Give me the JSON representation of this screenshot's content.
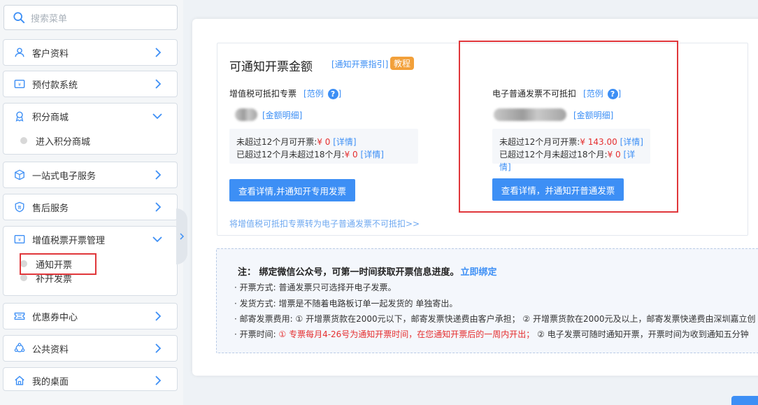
{
  "sidebar": {
    "search_placeholder": "搜索菜单",
    "items": [
      {
        "label": "客户资料"
      },
      {
        "label": "预付款系统"
      },
      {
        "label": "积分商城",
        "sub": [
          "进入积分商城"
        ]
      },
      {
        "label": "一站式电子服务"
      },
      {
        "label": "售后服务"
      },
      {
        "label": "增值税票开票管理",
        "sub": [
          "通知开票",
          "补开发票"
        ]
      },
      {
        "label": "优惠券中心"
      },
      {
        "label": "公共资料"
      },
      {
        "label": "我的桌面"
      }
    ]
  },
  "main": {
    "title": "可通知开票金额",
    "guide_link": "[通知开票指引]",
    "tutorial_badge": "教程",
    "left_col": {
      "title": "增值税可抵扣专票",
      "example": "[范例",
      "example_close": "]",
      "amount_detail": "[金额明细]",
      "line1_label": "未超过12个月可开票:",
      "line1_value": "¥ 0",
      "line1_detail": "[详情]",
      "line2_label": "已超过12个月未超过18个月:",
      "line2_value": "¥ 0",
      "line2_detail": "[详情]",
      "button": "查看详情,并通知开专用发票"
    },
    "right_col": {
      "title": "电子普通发票不可抵扣",
      "example": "[范例",
      "example_close": "]",
      "amount_detail": "[金额明细]",
      "line1_label": "未超过12个月可开票:",
      "line1_value": "¥ 143.00",
      "line1_detail": "[详情]",
      "line2_label": "已超过12个月未超过18个月:",
      "line2_value": "¥ 0",
      "line2_detail": "[详情]",
      "button": "查看详情，并通知开普通发票"
    },
    "convert_link": "将增值税可抵扣专票转为电子普通发票不可抵扣>>",
    "help_mark": "?"
  },
  "notes": {
    "title_prefix": "注：  绑定微信公众号，可第一时间获取开票信息进度。",
    "bind_link": "立即绑定",
    "rows": [
      {
        "prefix": "· 开票方式:  ",
        "text": "普通发票只可选择开电子发票。"
      },
      {
        "prefix": "· 发货方式:  ",
        "text": "增票是不随着电路板订单一起发货的 单独寄出。"
      },
      {
        "prefix": "· 邮寄发票费用:  ",
        "text": "① 开增票货款在2000元以下，邮寄发票快递费由客户承担；  ② 开增票货款在2000元及以上，邮寄发票快递费由深圳嘉立创"
      },
      {
        "prefix": "· 开票时间:  ",
        "red": "① 专票每月4-26号为通知开票时间，在您通知开票后的一周内开出；",
        "text": "  ② 电子发票可随时通知开票，开票时间为收到通知五分钟"
      }
    ]
  },
  "colors": {
    "accent": "#3d8ff5",
    "warning": "#f2a03a",
    "highlight": "#e0373b",
    "price_red": "#e52f2f"
  }
}
